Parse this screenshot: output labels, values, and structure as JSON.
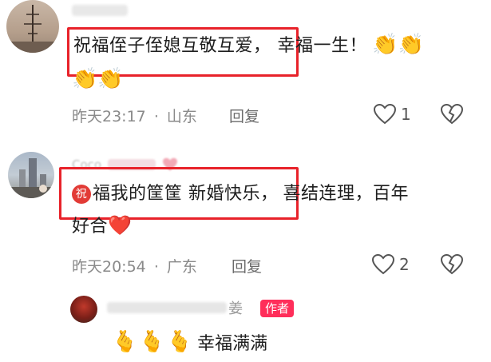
{
  "comments": [
    {
      "text_part1": "祝福侄子侄媳互敬互爱，",
      "text_part2": "幸福一生！",
      "emojis_line1": "👏👏",
      "emojis_line2": "👏👏",
      "time": "昨天23:17",
      "separator": "·",
      "location": "山东",
      "reply_label": "回复",
      "like_count": "1"
    },
    {
      "name_partial": "Coco",
      "badge_glyph": "祝",
      "text_part1": "福我的筐筐 新婚快乐，",
      "text_part2": "喜结连理，百年",
      "text_line2": "好合",
      "heart_emoji": "❤️",
      "time": "昨天20:54",
      "separator": "·",
      "location": "广东",
      "reply_label": "回复",
      "like_count": "2"
    }
  ],
  "reply": {
    "name_partial": "姜",
    "author_badge": "作者",
    "emojis": "🫰🫰🫰",
    "text": "幸福满满"
  }
}
